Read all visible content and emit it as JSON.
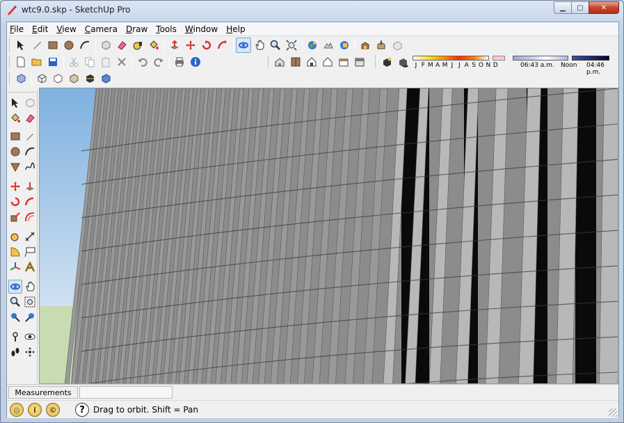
{
  "window": {
    "title": "wtc9.0.skp - SketchUp Pro",
    "minimize_glyph": "▁",
    "maximize_glyph": "▢",
    "close_glyph": "✕"
  },
  "menubar": {
    "items": [
      {
        "accel": "F",
        "rest": "ile"
      },
      {
        "accel": "E",
        "rest": "dit"
      },
      {
        "accel": "V",
        "rest": "iew"
      },
      {
        "accel": "C",
        "rest": "amera"
      },
      {
        "accel": "D",
        "rest": "raw"
      },
      {
        "accel": "T",
        "rest": "ools"
      },
      {
        "accel": "W",
        "rest": "indow"
      },
      {
        "accel": "H",
        "rest": "elp"
      }
    ]
  },
  "shadows": {
    "months": [
      "J",
      "F",
      "M",
      "A",
      "M",
      "J",
      "J",
      "A",
      "S",
      "O",
      "N",
      "D"
    ],
    "time_start": "06:43 a.m.",
    "time_noon": "Noon",
    "time_end": "04:46 p.m."
  },
  "measurements": {
    "label": "Measurements",
    "value": ""
  },
  "status": {
    "message": "Drag to orbit.  Shift = Pan",
    "help_glyph": "?",
    "geo_glyph": "◎",
    "credit_glyph": "i",
    "user_glyph": "©"
  },
  "icons": {
    "select": "select-arrow-icon",
    "orbit": "orbit-icon",
    "pan": "pan-icon",
    "zoom": "zoom-icon"
  },
  "colors": {
    "title_bar": "#c9d9ec",
    "close_button": "#c8442b",
    "active_tool": "#d8e6f6",
    "sky": "#9cc3e6",
    "ground": "#c8dcb2",
    "facade": "#8c8c8c"
  }
}
